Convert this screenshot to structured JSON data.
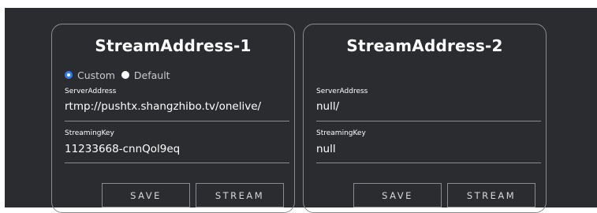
{
  "cards": [
    {
      "title": "StreamAddress-1",
      "radio": {
        "custom_label": "Custom",
        "default_label": "Default",
        "selected": "Custom"
      },
      "server_label": "ServerAddress",
      "server_value": "rtmp://pushtx.shangzhibo.tv/onelive/",
      "key_label": "StreamingKey",
      "key_value": "11233668-cnnQol9eq",
      "save_label": "SAVE",
      "stream_label": "STREAM"
    },
    {
      "title": "StreamAddress-2",
      "server_label": "ServerAddress",
      "server_value": "null/",
      "key_label": "StreamingKey",
      "key_value": "null",
      "save_label": "SAVE",
      "stream_label": "STREAM"
    }
  ],
  "colors": {
    "background": "#2b2c30",
    "border": "#8a8b90",
    "radio_accent": "#2f7df6"
  }
}
